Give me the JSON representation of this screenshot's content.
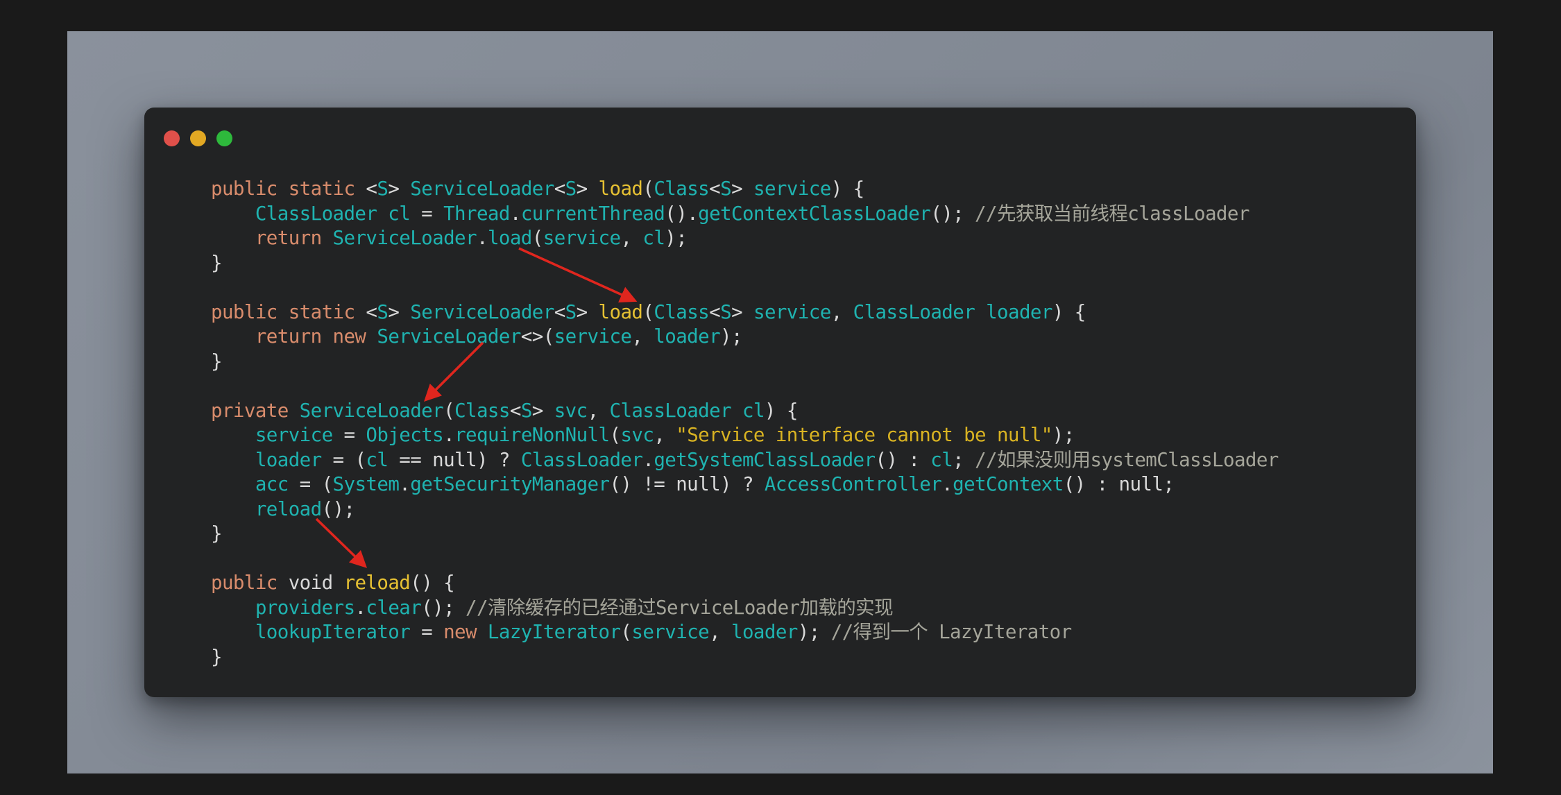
{
  "window": {
    "traffic_lights": [
      {
        "name": "close",
        "color": "#e0504a"
      },
      {
        "name": "minimize",
        "color": "#e2a823"
      },
      {
        "name": "maximize",
        "color": "#2eb93c"
      }
    ]
  },
  "code": {
    "lines": [
      [
        {
          "t": "kw",
          "v": "public static "
        },
        {
          "t": "pl",
          "v": "<"
        },
        {
          "t": "ty",
          "v": "S"
        },
        {
          "t": "pl",
          "v": "> "
        },
        {
          "t": "ty",
          "v": "ServiceLoader"
        },
        {
          "t": "pl",
          "v": "<"
        },
        {
          "t": "ty",
          "v": "S"
        },
        {
          "t": "pl",
          "v": "> "
        },
        {
          "t": "fn",
          "v": "load"
        },
        {
          "t": "pl",
          "v": "("
        },
        {
          "t": "ty",
          "v": "Class"
        },
        {
          "t": "pl",
          "v": "<"
        },
        {
          "t": "ty",
          "v": "S"
        },
        {
          "t": "pl",
          "v": "> "
        },
        {
          "t": "ty",
          "v": "service"
        },
        {
          "t": "pl",
          "v": ") {"
        }
      ],
      [
        {
          "t": "pl",
          "v": "    "
        },
        {
          "t": "ty",
          "v": "ClassLoader cl"
        },
        {
          "t": "pl",
          "v": " = "
        },
        {
          "t": "ty",
          "v": "Thread"
        },
        {
          "t": "pl",
          "v": "."
        },
        {
          "t": "ty",
          "v": "currentThread"
        },
        {
          "t": "pl",
          "v": "()."
        },
        {
          "t": "ty",
          "v": "getContextClassLoader"
        },
        {
          "t": "pl",
          "v": "(); "
        },
        {
          "t": "cm",
          "v": "//先获取当前线程classLoader"
        }
      ],
      [
        {
          "t": "pl",
          "v": "    "
        },
        {
          "t": "kw",
          "v": "return "
        },
        {
          "t": "ty",
          "v": "ServiceLoader"
        },
        {
          "t": "pl",
          "v": "."
        },
        {
          "t": "ty",
          "v": "load"
        },
        {
          "t": "pl",
          "v": "("
        },
        {
          "t": "ty",
          "v": "service"
        },
        {
          "t": "pl",
          "v": ", "
        },
        {
          "t": "ty",
          "v": "cl"
        },
        {
          "t": "pl",
          "v": ");"
        }
      ],
      [
        {
          "t": "pl",
          "v": "}"
        }
      ],
      [],
      [
        {
          "t": "kw",
          "v": "public static "
        },
        {
          "t": "pl",
          "v": "<"
        },
        {
          "t": "ty",
          "v": "S"
        },
        {
          "t": "pl",
          "v": "> "
        },
        {
          "t": "ty",
          "v": "ServiceLoader"
        },
        {
          "t": "pl",
          "v": "<"
        },
        {
          "t": "ty",
          "v": "S"
        },
        {
          "t": "pl",
          "v": "> "
        },
        {
          "t": "fn",
          "v": "load"
        },
        {
          "t": "pl",
          "v": "("
        },
        {
          "t": "ty",
          "v": "Class"
        },
        {
          "t": "pl",
          "v": "<"
        },
        {
          "t": "ty",
          "v": "S"
        },
        {
          "t": "pl",
          "v": "> "
        },
        {
          "t": "ty",
          "v": "service"
        },
        {
          "t": "pl",
          "v": ", "
        },
        {
          "t": "ty",
          "v": "ClassLoader loader"
        },
        {
          "t": "pl",
          "v": ") {"
        }
      ],
      [
        {
          "t": "pl",
          "v": "    "
        },
        {
          "t": "kw",
          "v": "return new "
        },
        {
          "t": "ty",
          "v": "ServiceLoader"
        },
        {
          "t": "pl",
          "v": "<>("
        },
        {
          "t": "ty",
          "v": "service"
        },
        {
          "t": "pl",
          "v": ", "
        },
        {
          "t": "ty",
          "v": "loader"
        },
        {
          "t": "pl",
          "v": ");"
        }
      ],
      [
        {
          "t": "pl",
          "v": "}"
        }
      ],
      [],
      [
        {
          "t": "kw",
          "v": "private "
        },
        {
          "t": "ty",
          "v": "ServiceLoader"
        },
        {
          "t": "pl",
          "v": "("
        },
        {
          "t": "ty",
          "v": "Class"
        },
        {
          "t": "pl",
          "v": "<"
        },
        {
          "t": "ty",
          "v": "S"
        },
        {
          "t": "pl",
          "v": "> "
        },
        {
          "t": "ty",
          "v": "svc"
        },
        {
          "t": "pl",
          "v": ", "
        },
        {
          "t": "ty",
          "v": "ClassLoader cl"
        },
        {
          "t": "pl",
          "v": ") {"
        }
      ],
      [
        {
          "t": "pl",
          "v": "    "
        },
        {
          "t": "ty",
          "v": "service"
        },
        {
          "t": "pl",
          "v": " = "
        },
        {
          "t": "ty",
          "v": "Objects"
        },
        {
          "t": "pl",
          "v": "."
        },
        {
          "t": "ty",
          "v": "requireNonNull"
        },
        {
          "t": "pl",
          "v": "("
        },
        {
          "t": "ty",
          "v": "svc"
        },
        {
          "t": "pl",
          "v": ", "
        },
        {
          "t": "str",
          "v": "\"Service interface cannot be null\""
        },
        {
          "t": "pl",
          "v": ");"
        }
      ],
      [
        {
          "t": "pl",
          "v": "    "
        },
        {
          "t": "ty",
          "v": "loader"
        },
        {
          "t": "pl",
          "v": " = ("
        },
        {
          "t": "ty",
          "v": "cl"
        },
        {
          "t": "pl",
          "v": " == null) ? "
        },
        {
          "t": "ty",
          "v": "ClassLoader"
        },
        {
          "t": "pl",
          "v": "."
        },
        {
          "t": "ty",
          "v": "getSystemClassLoader"
        },
        {
          "t": "pl",
          "v": "() : "
        },
        {
          "t": "ty",
          "v": "cl"
        },
        {
          "t": "pl",
          "v": "; "
        },
        {
          "t": "cm",
          "v": "//如果没则用systemClassLoader"
        }
      ],
      [
        {
          "t": "pl",
          "v": "    "
        },
        {
          "t": "ty",
          "v": "acc"
        },
        {
          "t": "pl",
          "v": " = ("
        },
        {
          "t": "ty",
          "v": "System"
        },
        {
          "t": "pl",
          "v": "."
        },
        {
          "t": "ty",
          "v": "getSecurityManager"
        },
        {
          "t": "pl",
          "v": "() != null) ? "
        },
        {
          "t": "ty",
          "v": "AccessController"
        },
        {
          "t": "pl",
          "v": "."
        },
        {
          "t": "ty",
          "v": "getContext"
        },
        {
          "t": "pl",
          "v": "() : null;"
        }
      ],
      [
        {
          "t": "pl",
          "v": "    "
        },
        {
          "t": "ty",
          "v": "reload"
        },
        {
          "t": "pl",
          "v": "();"
        }
      ],
      [
        {
          "t": "pl",
          "v": "}"
        }
      ],
      [],
      [
        {
          "t": "kw",
          "v": "public "
        },
        {
          "t": "pl",
          "v": "void "
        },
        {
          "t": "fn",
          "v": "reload"
        },
        {
          "t": "pl",
          "v": "() {"
        }
      ],
      [
        {
          "t": "pl",
          "v": "    "
        },
        {
          "t": "ty",
          "v": "providers"
        },
        {
          "t": "pl",
          "v": "."
        },
        {
          "t": "ty",
          "v": "clear"
        },
        {
          "t": "pl",
          "v": "(); "
        },
        {
          "t": "cm",
          "v": "//清除缓存的已经通过ServiceLoader加载的实现"
        }
      ],
      [
        {
          "t": "pl",
          "v": "    "
        },
        {
          "t": "ty",
          "v": "lookupIterator"
        },
        {
          "t": "pl",
          "v": " = "
        },
        {
          "t": "kw",
          "v": "new "
        },
        {
          "t": "ty",
          "v": "LazyIterator"
        },
        {
          "t": "pl",
          "v": "("
        },
        {
          "t": "ty",
          "v": "service"
        },
        {
          "t": "pl",
          "v": ", "
        },
        {
          "t": "ty",
          "v": "loader"
        },
        {
          "t": "pl",
          "v": "); "
        },
        {
          "t": "cm",
          "v": "//得到一个 LazyIterator"
        }
      ],
      [
        {
          "t": "pl",
          "v": "}"
        }
      ]
    ]
  },
  "annotations": {
    "arrow_color": "#e0261e",
    "arrows": [
      {
        "from": "ServiceLoader.load call",
        "to": "load(Class<S> service, ClassLoader loader)"
      },
      {
        "from": "new ServiceLoader<>",
        "to": "private ServiceLoader constructor"
      },
      {
        "from": "reload() call",
        "to": "public void reload()"
      }
    ]
  }
}
